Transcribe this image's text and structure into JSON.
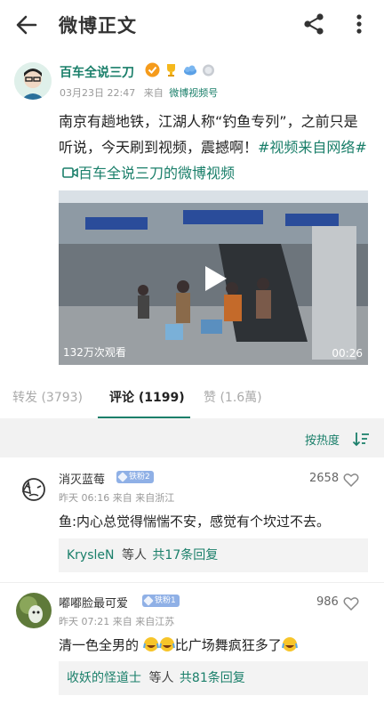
{
  "header": {
    "title": "微博正文"
  },
  "post": {
    "author": "百车全说三刀",
    "time": "03月23日 22:47",
    "source_prefix": "来自",
    "source": "微博视频号",
    "text_main": "南京有趟地铁，江湖人称“钓鱼专列”，之前只是听说，今天刷到视频，震撼啊！",
    "hashtag": "#视频来自网络#",
    "video_link": "百车全说三刀的微博视频"
  },
  "video": {
    "views": "132万次观看",
    "duration": "00:26"
  },
  "tabs": {
    "repost": "转发 (3793)",
    "comments": "评论 (1199)",
    "likes": "赞 (1.6萬)"
  },
  "sort": {
    "label": "按热度"
  },
  "comments": [
    {
      "user": "消灭蓝莓",
      "badge": "铁粉2",
      "meta": "昨天 06:16 来自 来自浙江",
      "likes": "2658",
      "text": "鱼:内心总觉得惴惴不安，感觉有个坎过不去。",
      "reply_user": "KrysleN",
      "reply_mid": "等人",
      "reply_count": "共17条回复"
    },
    {
      "user": "嘟嘟脸最可爱",
      "badge": "铁粉1",
      "meta": "昨天 07:21 来自 来自江苏",
      "likes": "986",
      "text_a": "清一色全男的",
      "text_b": "比广场舞疯狂多了",
      "reply_user": "收妖的怪道士",
      "reply_mid": "等人",
      "reply_count": "共81条回复"
    }
  ],
  "colors": {
    "accent": "#1a7f6a",
    "sort_bg": "#f2f2f2",
    "badge": "#8fb0e6"
  },
  "icons": [
    "back-arrow-icon",
    "share-icon",
    "more-icon",
    "verified-icon",
    "play-icon",
    "sort-icon",
    "heart-icon",
    "video-camera-icon",
    "laugh-cry-emoji"
  ]
}
